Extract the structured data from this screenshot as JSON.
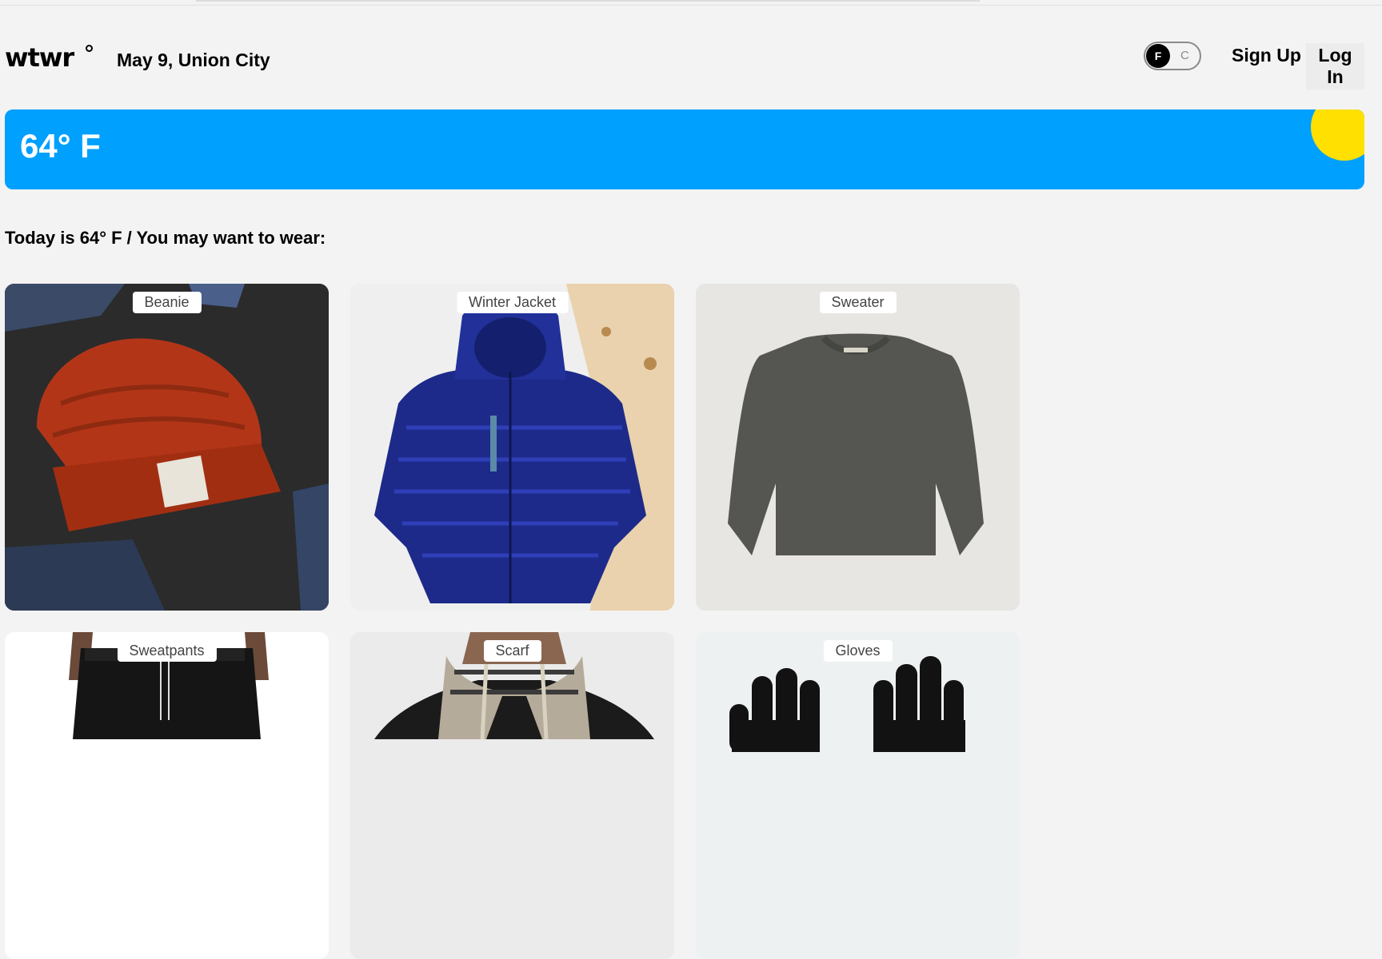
{
  "header": {
    "logo": "wtwr",
    "date_location": "May 9, Union City",
    "toggle": {
      "active": "F",
      "inactive": "C"
    },
    "signup_label": "Sign Up",
    "login_label": "Log In"
  },
  "weather": {
    "temperature": "64° F",
    "accent_color": "#00a0ff",
    "sun_color": "#ffe000"
  },
  "recommendation": "Today is 64° F / You may want to wear:",
  "items": [
    {
      "name": "Beanie",
      "image": "red-beanie-icon"
    },
    {
      "name": "Winter Jacket",
      "image": "blue-puffer-jacket-icon"
    },
    {
      "name": "Sweater",
      "image": "grey-sweater-icon"
    },
    {
      "name": "Sweatpants",
      "image": "black-sweatpants-icon"
    },
    {
      "name": "Scarf",
      "image": "plaid-scarf-icon"
    },
    {
      "name": "Gloves",
      "image": "black-gloves-icon"
    }
  ]
}
